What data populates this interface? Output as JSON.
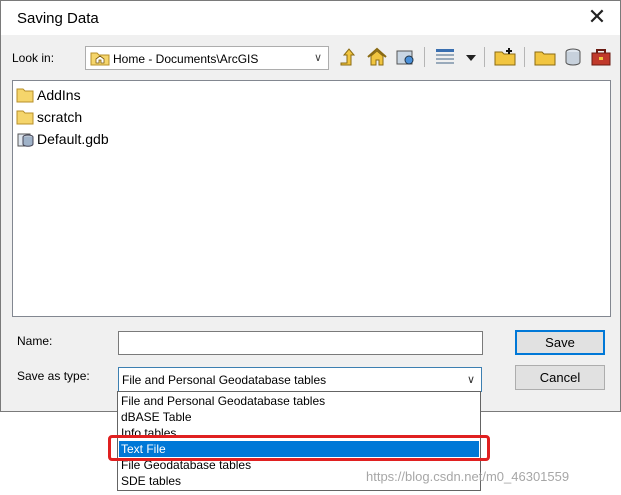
{
  "window": {
    "title": "Saving Data",
    "close_glyph": "✕"
  },
  "look_in": {
    "label": "Look in:",
    "value": "Home - Documents\\ArcGIS"
  },
  "toolbar": {
    "icons": [
      "up-one-level-icon",
      "home-icon",
      "connect-folder-icon",
      "view-options-icon",
      "dropdown-arrow-icon",
      "new-folder-icon",
      "folder-icon",
      "database-icon",
      "toolbox-icon"
    ]
  },
  "files": [
    {
      "name": "AddIns",
      "icon": "folder-icon"
    },
    {
      "name": "scratch",
      "icon": "folder-icon"
    },
    {
      "name": "Default.gdb",
      "icon": "geodatabase-icon"
    }
  ],
  "name_field": {
    "label": "Name:",
    "value": ""
  },
  "save_type": {
    "label": "Save as type:",
    "value": "File and Personal Geodatabase tables",
    "options": [
      "File and Personal Geodatabase tables",
      "dBASE Table",
      "Info tables",
      "Text File",
      "File Geodatabase tables",
      "SDE tables"
    ],
    "selected": "Text File"
  },
  "buttons": {
    "save": "Save",
    "cancel": "Cancel"
  },
  "watermark": "https://blog.csdn.net/m0_46301559",
  "colors": {
    "selection": "#0078d7",
    "highlight_box": "#e02020",
    "folder": "#f5d56b"
  }
}
